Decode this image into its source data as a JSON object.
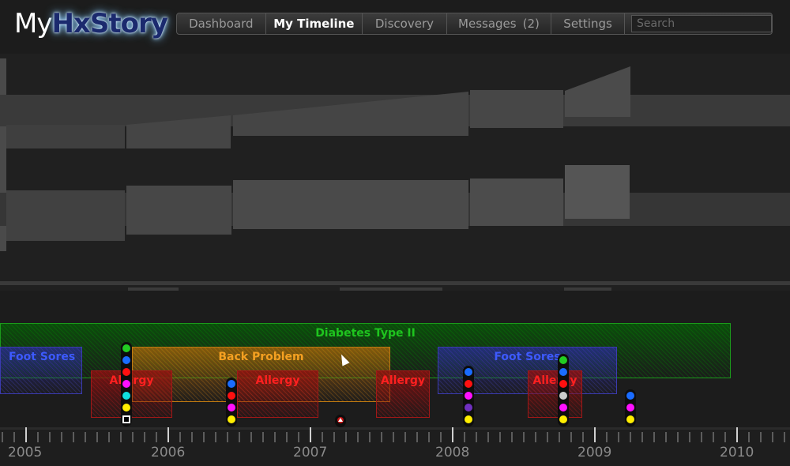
{
  "app": {
    "title_prefix": "My",
    "title_brand": "HxStory"
  },
  "nav": {
    "tabs": [
      {
        "label": "Dashboard"
      },
      {
        "label": "My Timeline",
        "active": true
      },
      {
        "label": "Discovery"
      },
      {
        "label": "Messages",
        "count": "(2)"
      },
      {
        "label": "Settings"
      }
    ],
    "search": {
      "placeholder": "Search",
      "value": ""
    }
  },
  "timeline": {
    "bands": {
      "diabetes": "Diabetes Type II",
      "foot_sores_1": "Foot Sores",
      "foot_sores_2": "Foot Sores",
      "back_problem": "Back Problem",
      "allergy_1": "Allergy",
      "allergy_2": "Allergy",
      "allergy_3": "Allergy",
      "allergy_4": "Allergy"
    },
    "event_stacks": [
      {
        "colors": [
          "#22cc22",
          "#1a6cff",
          "#ff1010",
          "#ff10ff",
          "#10e0e0",
          "#ffee00",
          "box"
        ]
      },
      {
        "colors": [
          "#1a6cff",
          "#ff1010",
          "#ff10ff",
          "#ffee00"
        ]
      },
      {
        "colors": [
          "#1a6cff",
          "#ff1010",
          "#ff10ff",
          "#7030c0",
          "#ffee00"
        ]
      },
      {
        "colors": [
          "#22cc22",
          "#1a6cff",
          "#ff1010",
          "#cccccc",
          "#ff10ff",
          "#ffee00"
        ]
      },
      {
        "colors": [
          "#1a6cff",
          "#ff10ff",
          "#ffee00"
        ]
      }
    ],
    "years": [
      "2005",
      "2006",
      "2007",
      "2008",
      "2009",
      "2010"
    ]
  }
}
